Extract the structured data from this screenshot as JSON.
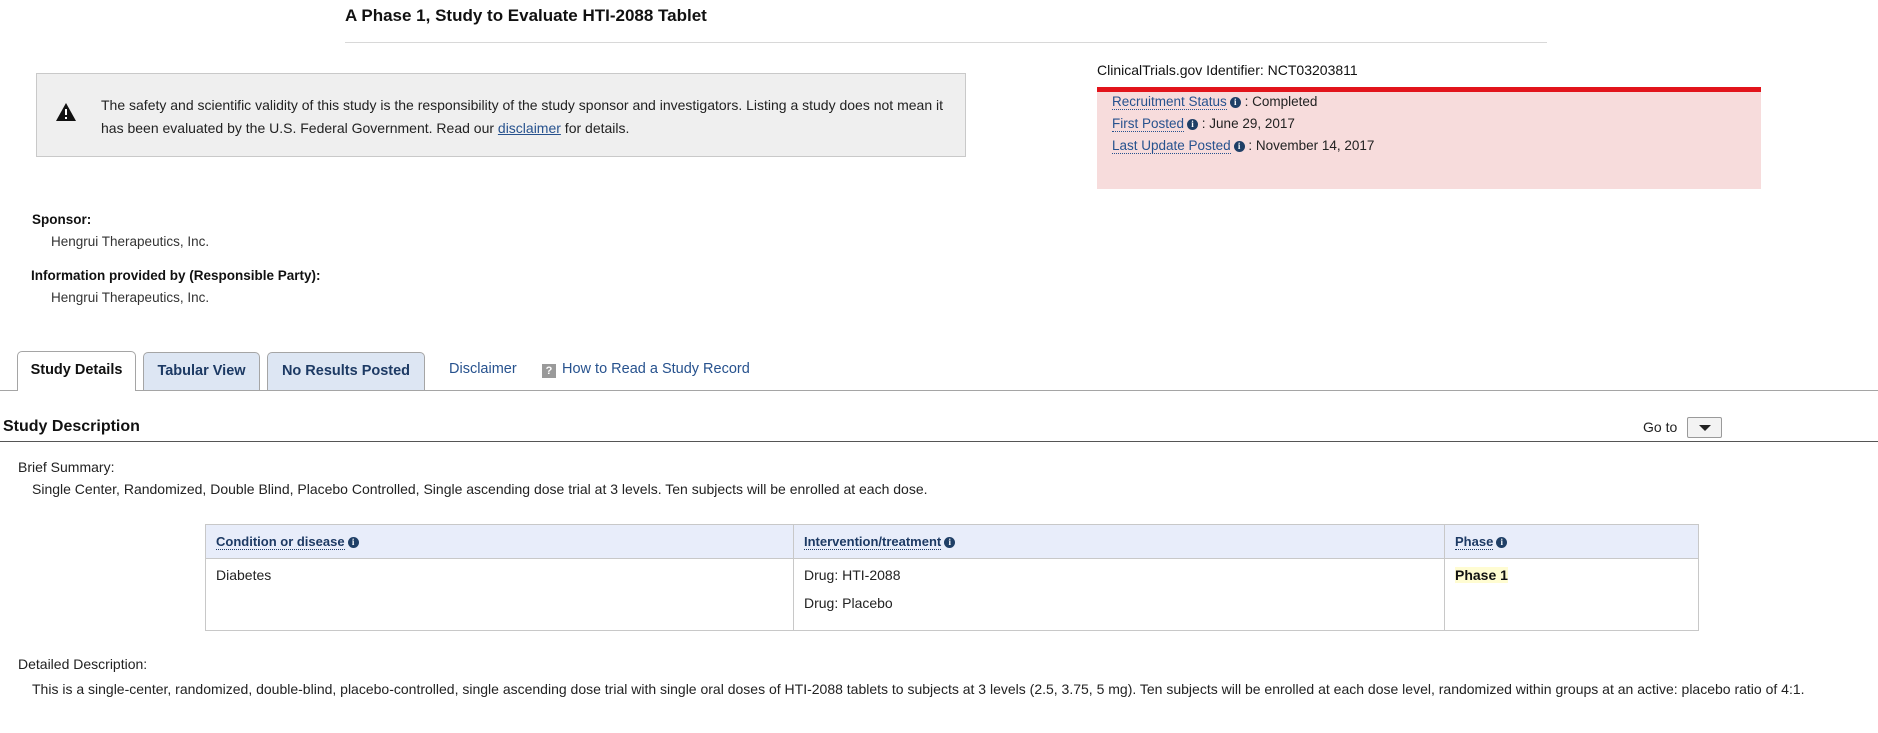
{
  "page_title": "A Phase 1, Study to Evaluate HTI-2088 Tablet",
  "disclaimer": {
    "text_before": "The safety and scientific validity of this study is the responsibility of the study sponsor and investigators. Listing a study does not mean it has been evaluated by the U.S. Federal Government. Read our ",
    "link": "disclaimer",
    "text_after": " for details."
  },
  "identifier": "ClinicalTrials.gov Identifier: NCT03203811",
  "status": {
    "recruitment_label": "Recruitment Status",
    "recruitment_value": ": Completed",
    "first_posted_label": "First Posted",
    "first_posted_value": ": June 29, 2017",
    "last_update_label": "Last Update Posted",
    "last_update_value": ": November 14, 2017"
  },
  "sponsor": {
    "label": "Sponsor:",
    "value": "Hengrui Therapeutics, Inc."
  },
  "responsible_party": {
    "label": "Information provided by (Responsible Party):",
    "value": "Hengrui Therapeutics, Inc."
  },
  "tabs": {
    "study_details": "Study Details",
    "tabular_view": "Tabular View",
    "no_results": "No Results Posted",
    "disclaimer": "Disclaimer",
    "how_to_read": "How to Read a Study Record"
  },
  "section": {
    "title": "Study Description",
    "goto": "Go to"
  },
  "brief_summary": {
    "label": "Brief Summary:",
    "text": "Single Center, Randomized, Double Blind, Placebo Controlled, Single ascending dose trial at 3 levels. Ten subjects will be enrolled at each dose."
  },
  "conditions_table": {
    "headers": [
      "Condition or disease",
      "Intervention/treatment",
      "Phase"
    ],
    "condition": "Diabetes",
    "interventions": [
      "Drug: HTI-2088",
      "Drug: Placebo"
    ],
    "phase": "Phase 1"
  },
  "detailed_description": {
    "label": "Detailed Description:",
    "text": "This is a single-center, randomized, double-blind, placebo-controlled, single ascending dose trial with single oral doses of HTI-2088 tablets to subjects at 3 levels (2.5, 3.75, 5 mg). Ten subjects will be enrolled at each dose level, randomized within groups at an active: placebo ratio of 4:1."
  },
  "colors": {
    "status_bar": "#e2141b",
    "status_bg": "#f7dcdc",
    "link": "#27528e",
    "tab_inactive_bg": "#dde6f3",
    "table_header_bg": "#e8edfa"
  }
}
